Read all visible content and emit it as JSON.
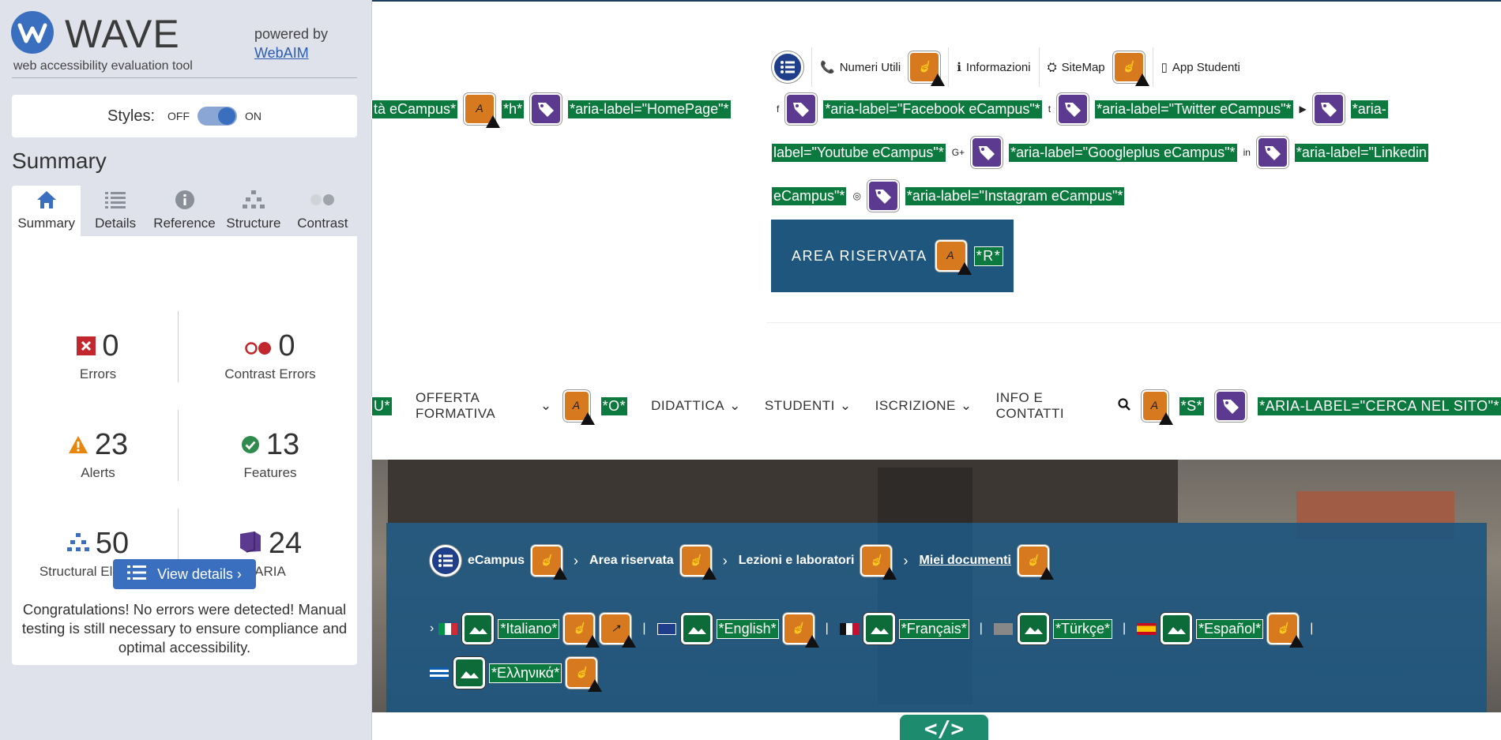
{
  "wave": {
    "title": "WAVE",
    "tagline": "web accessibility evaluation tool",
    "powered_by": "powered by",
    "webaim": "WebAIM",
    "styles_label": "Styles:",
    "styles_off": "OFF",
    "styles_on": "ON",
    "summary_heading": "Summary",
    "tabs": [
      {
        "label": "Summary",
        "icon": "home-icon"
      },
      {
        "label": "Details",
        "icon": "list-icon"
      },
      {
        "label": "Reference",
        "icon": "info-icon"
      },
      {
        "label": "Structure",
        "icon": "hierarchy-icon"
      },
      {
        "label": "Contrast",
        "icon": "contrast-icon"
      }
    ],
    "stats": {
      "errors": {
        "value": "0",
        "label": "Errors"
      },
      "contrast": {
        "value": "0",
        "label": "Contrast Errors"
      },
      "alerts": {
        "value": "23",
        "label": "Alerts"
      },
      "features": {
        "value": "13",
        "label": "Features"
      },
      "structural": {
        "value": "50",
        "label": "Structural Elements"
      },
      "aria": {
        "value": "24",
        "label": "ARIA"
      }
    },
    "view_details": "View details ›",
    "congrats": "Congratulations! No errors were detected! Manual testing is still necessary to ensure compliance and optimal accessibility."
  },
  "page": {
    "homepage_label": "tà eCampus*",
    "h_label": "*h*",
    "aria_homepage": "*aria-label=\"HomePage\"*",
    "topbar": {
      "numeri": "Numeri Utili",
      "informazioni": "Informazioni",
      "sitemap": "SiteMap",
      "app": "App Studenti"
    },
    "social": {
      "facebook": "*aria-label=\"Facebook eCampus\"*",
      "twitter": "*aria-label=\"Twitter eCampus\"*",
      "youtube_a": "*aria-",
      "youtube_b": "label=\"Youtube eCampus\"*",
      "googleplus": "*aria-label=\"Googleplus eCampus\"*",
      "linkedin_a": "*aria-label=\"Linkedin",
      "linkedin_b": "eCampus\"*",
      "instagram": "*aria-label=\"Instagram eCampus\"*"
    },
    "area_riservata": "AREA RISERVATA",
    "r_label": "*R*",
    "nav": {
      "u_label": "U*",
      "offerta": "OFFERTA FORMATIVA",
      "o_label": "*O*",
      "didattica": "DIDATTICA",
      "studenti": "STUDENTI",
      "iscrizione": "ISCRIZIONE",
      "info": "INFO E CONTATTI",
      "s_label": "*S*",
      "cerca": "*ARIA-LABEL=\"CERCA NEL SITO\"*"
    },
    "breadcrumb": [
      "eCampus",
      "Area riservata",
      "Lezioni e laboratori",
      "Miei documenti"
    ],
    "languages": [
      "*Italiano*",
      "*English*",
      "*Français*",
      "*Türkçe*",
      "*Español*",
      "*Ελληνικά*"
    ],
    "code_tab": "</>"
  },
  "colors": {
    "wave_blue": "#3a6fbf",
    "wave_bg": "#dfe2ea",
    "feature_green": "#0c7a3e",
    "alert_orange": "#d77a1f",
    "aria_purple": "#5b3a8f",
    "site_blue": "#1f567e"
  }
}
